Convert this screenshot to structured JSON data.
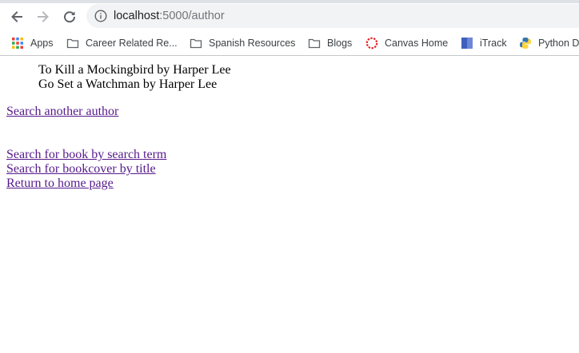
{
  "browser": {
    "url_host": "localhost",
    "url_path": ":5000/author"
  },
  "bookmarks": [
    {
      "label": "Apps",
      "icon": "apps-grid-icon"
    },
    {
      "label": "Career Related Re...",
      "icon": "folder-icon"
    },
    {
      "label": "Spanish Resources",
      "icon": "folder-icon"
    },
    {
      "label": "Blogs",
      "icon": "folder-icon"
    },
    {
      "label": "Canvas Home",
      "icon": "canvas-icon"
    },
    {
      "label": "iTrack",
      "icon": "itrack-icon"
    },
    {
      "label": "Python D",
      "icon": "python-icon"
    }
  ],
  "page": {
    "books": [
      "To Kill a Mockingbird by Harper Lee",
      "Go Set a Watchman by Harper Lee"
    ],
    "search_another_author": "Search another author",
    "links": [
      "Search for book by search term",
      "Search for bookcover by title",
      "Return to home page"
    ],
    "link_color": "#551a8b"
  }
}
